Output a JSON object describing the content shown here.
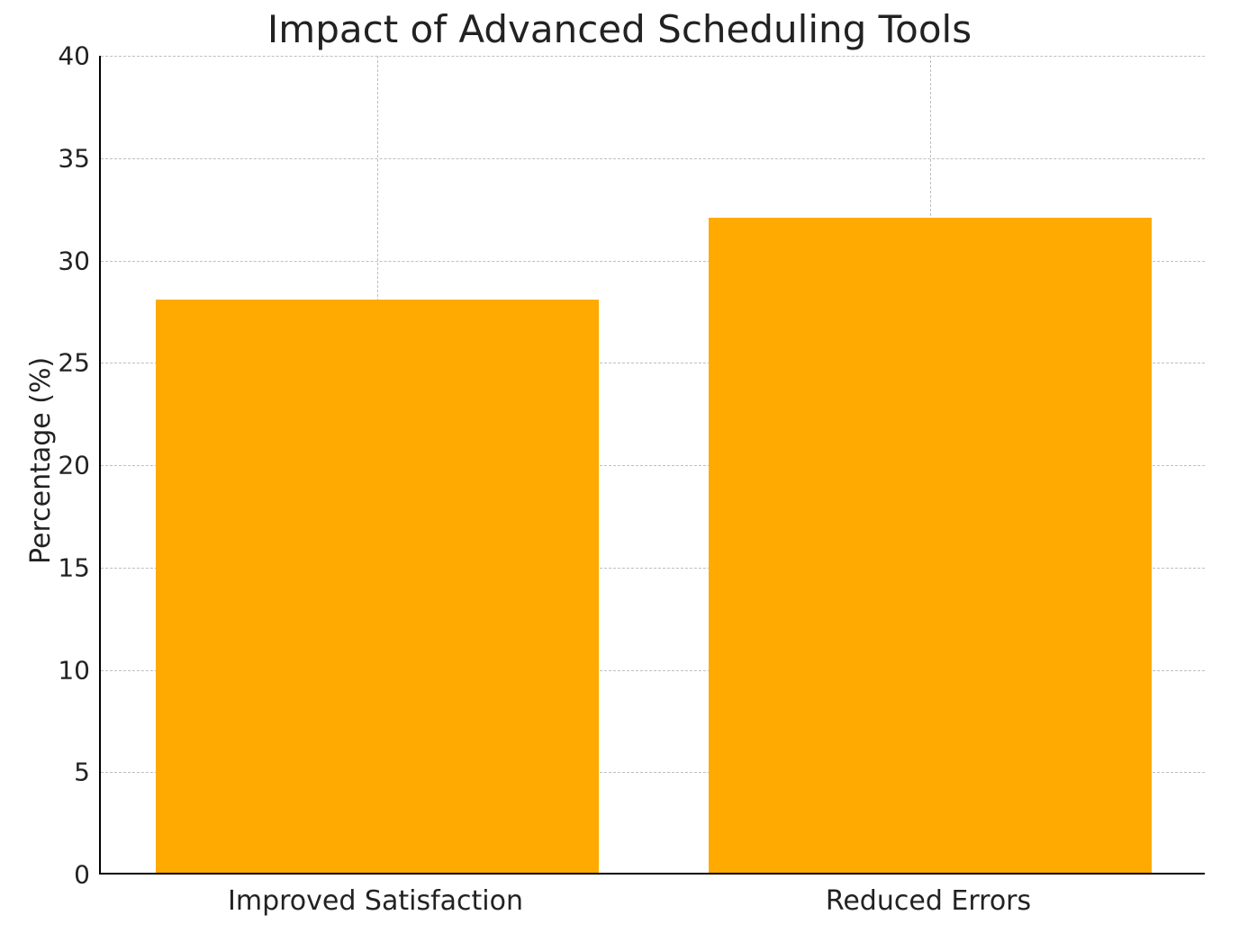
{
  "chart_data": {
    "type": "bar",
    "title": "Impact of Advanced Scheduling Tools",
    "xlabel": "",
    "ylabel": "Percentage (%)",
    "categories": [
      "Improved Satisfaction",
      "Reduced Errors"
    ],
    "values": [
      28,
      32
    ],
    "ylim": [
      0,
      40
    ],
    "yticks": [
      0,
      5,
      10,
      15,
      20,
      25,
      30,
      35,
      40
    ],
    "bar_color": "#ffaa00",
    "grid": true
  }
}
